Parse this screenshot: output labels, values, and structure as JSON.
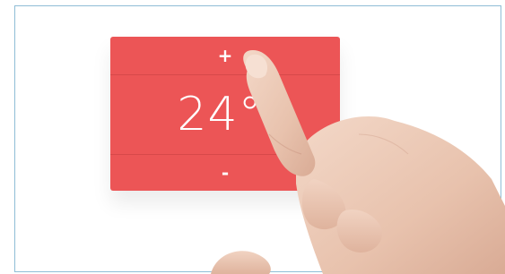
{
  "thermostat": {
    "increase_label": "+",
    "temperature": "24°",
    "decrease_label": "-",
    "panel_color": "#ec5556"
  },
  "icons": {
    "hand": "pointing-finger"
  }
}
